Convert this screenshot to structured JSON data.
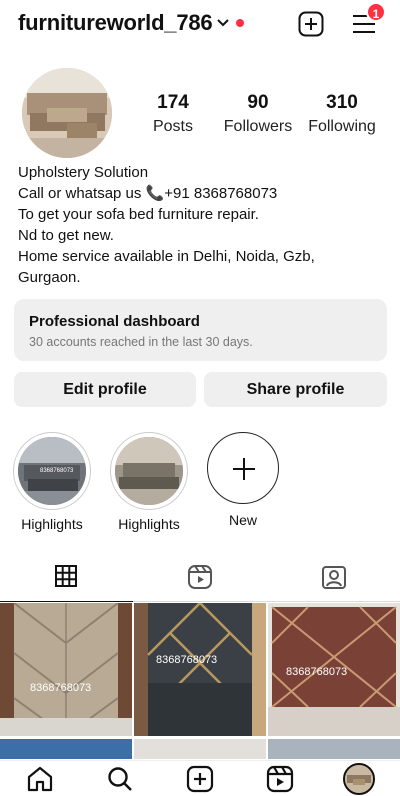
{
  "header": {
    "username": "furnitureworld_786",
    "notification_count": "1"
  },
  "profile": {
    "stats": [
      {
        "value": "174",
        "label": "Posts"
      },
      {
        "value": "90",
        "label": "Followers"
      },
      {
        "value": "310",
        "label": "Following"
      }
    ],
    "bio_lines": [
      "Upholstery Solution",
      "Call or whatsap us 📞+91 8368768073",
      "To get your sofa bed furniture repair.",
      "Nd to get new.",
      "Home service available in Delhi, Noida, Gzb,",
      "Gurgaon."
    ]
  },
  "dashboard": {
    "title": "Professional dashboard",
    "subtitle": "30 accounts reached in the last 30 days."
  },
  "buttons": {
    "edit": "Edit profile",
    "share": "Share profile"
  },
  "highlights": [
    {
      "label": "Highlights",
      "watermark": "8368768073"
    },
    {
      "label": "Highlights"
    },
    {
      "label": "New"
    }
  ],
  "posts": [
    {
      "watermark": "8368768073"
    },
    {
      "watermark": "8368768073"
    },
    {
      "watermark": "8368768073"
    }
  ],
  "icons": {
    "header": [
      "chevron-down-icon",
      "new-post-icon",
      "menu-icon"
    ],
    "tabs": [
      "grid-icon",
      "reels-icon",
      "tagged-icon"
    ],
    "bottom_nav": [
      "home-icon",
      "search-icon",
      "create-icon",
      "reels-icon",
      "profile-avatar"
    ]
  },
  "colors": {
    "accent_red": "#ff3040",
    "button_bg": "#efefef"
  }
}
